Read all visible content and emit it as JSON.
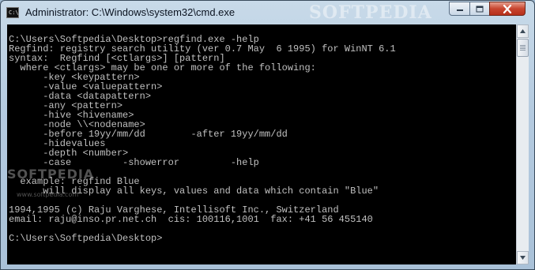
{
  "window": {
    "title": "Administrator: C:\\Windows\\system32\\cmd.exe",
    "icon_label": "C:\\",
    "watermark": "SOFTPEDIA"
  },
  "controls": {
    "minimize_icon": "minimize-icon",
    "maximize_icon": "maximize-icon",
    "close_icon": "close-icon"
  },
  "console": {
    "text": "C:\\Users\\Softpedia\\Desktop>regfind.exe -help\nRegfind: registry search utility (ver 0.7 May  6 1995) for WinNT 6.1\nsyntax:  Regfind [<ctlargs>] [pattern]\n  where <ctlargs> may be one or more of the following:\n      -key <keypattern>\n      -value <valuepattern>\n      -data <datapattern>\n      -any <pattern>\n      -hive <hivename>\n      -node \\\\<nodename>\n      -before 19yy/mm/dd        -after 19yy/mm/dd\n      -hidevalues\n      -depth <number>\n      -case         -showerror         -help\n\n  example: regfind Blue\n      will display all keys, values and data which contain \"Blue\"\n\n1994,1995 (c) Raju Varghese, Intellisoft Inc., Switzerland\nemail: raju@inso.pr.net.ch  cis: 100116,1001  fax: +41 56 455140\n\nC:\\Users\\Softpedia\\Desktop>",
    "watermark_brand": "SOFTPEDIA",
    "watermark_url": "www.softpedia.com"
  },
  "colors": {
    "console_bg": "#000000",
    "console_fg": "#c0c0c0",
    "close_button": "#c8452f"
  }
}
